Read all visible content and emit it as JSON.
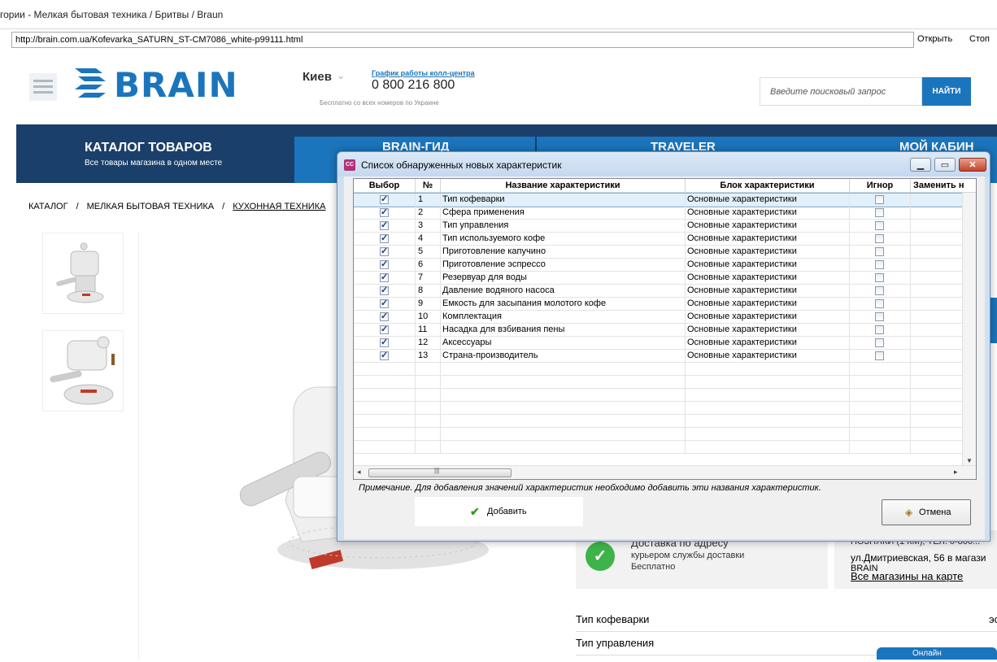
{
  "window": {
    "title": "гории - Мелкая бытовая техника / Бритвы / Braun",
    "url": "http://brain.com.ua/Kofevarka_SATURN_ST-CM7086_white-p99111.html",
    "open_label": "Открыть",
    "stop_label": "Стоп"
  },
  "site": {
    "logo": "BRAIN",
    "city": "Киев",
    "call_hours": "График работы колл-центра",
    "phone": "0 800 216 800",
    "free_call": "Бесплатно со всех номеров по Украине",
    "search_placeholder": "Введите поисковый запрос",
    "search_button": "НАЙТИ",
    "nav": {
      "catalog_title": "КАТАЛОГ ТОВАРОВ",
      "catalog_sub": "Все товары магазина в одном месте",
      "item2": "BRAIN-ГИД",
      "item3": "TRAVELER",
      "item4": "МОЙ КАБИН"
    },
    "breadcrumb": [
      "КАТАЛОГ",
      "/",
      "МЕЛКАЯ БЫТОВАЯ ТЕХНИКА",
      "/",
      "КУХОННАЯ ТЕХНИКА"
    ],
    "delivery": {
      "title": "Доставка по адресу",
      "sub1": "курьером службы доставки",
      "sub2": "Бесплатно"
    },
    "store": {
      "cut_text": "ПОЗНЯКИ (1 КМ), ТЕЛ. 0-800...",
      "address": "ул.Дмитриевская, 56 в магази",
      "brand": "BRAIN",
      "map_link": "Все магазины на карте"
    },
    "specs": [
      {
        "name": "Тип кофеварки",
        "value": "эс"
      },
      {
        "name": "Тип управления",
        "value": ""
      }
    ],
    "chat_label": "Онлайн"
  },
  "dialog": {
    "icon_label": "CC",
    "title": "Список обнаруженных новых характеристик",
    "columns": [
      "Выбор",
      "№",
      "Название характеристики",
      "Блок характеристики",
      "Игнор",
      "Заменить н"
    ],
    "rows": [
      {
        "n": "1",
        "name": "Тип кофеварки",
        "block": "Основные характеристики"
      },
      {
        "n": "2",
        "name": "Сфера применения",
        "block": "Основные характеристики"
      },
      {
        "n": "3",
        "name": "Тип управления",
        "block": "Основные характеристики"
      },
      {
        "n": "4",
        "name": "Тип используемого кофе",
        "block": "Основные характеристики"
      },
      {
        "n": "5",
        "name": "Приготовление капучино",
        "block": "Основные характеристики"
      },
      {
        "n": "6",
        "name": "Приготовление эспрессо",
        "block": "Основные характеристики"
      },
      {
        "n": "7",
        "name": "Резервуар для воды",
        "block": "Основные характеристики"
      },
      {
        "n": "8",
        "name": "Давление водяного насоса",
        "block": "Основные характеристики"
      },
      {
        "n": "9",
        "name": "Емкость для засыпания молотого кофе",
        "block": "Основные характеристики"
      },
      {
        "n": "10",
        "name": "Комплектация",
        "block": "Основные характеристики"
      },
      {
        "n": "11",
        "name": "Насадка для взбивания пены",
        "block": "Основные характеристики"
      },
      {
        "n": "12",
        "name": "Аксессуары",
        "block": "Основные характеристики"
      },
      {
        "n": "13",
        "name": "Страна-производитель",
        "block": "Основные характеристики"
      }
    ],
    "note": "Примечание. Для добавления значений характеристик необходимо добавить эти названия характеристик.",
    "add_label": "Добавить",
    "cancel_label": "Отмена"
  },
  "colors": {
    "brand_blue": "#1b75bc",
    "nav_dark": "#1a3f6a",
    "dialog_frame": "#cfe0f2",
    "ok_green": "#3db34a"
  }
}
